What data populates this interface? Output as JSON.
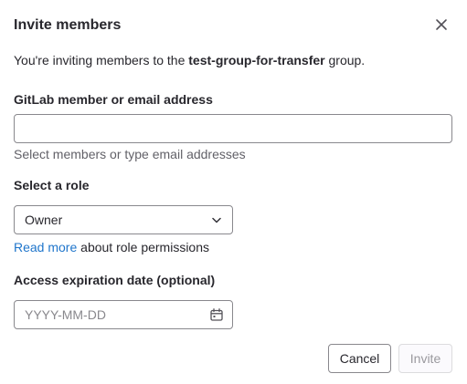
{
  "modal": {
    "title": "Invite members",
    "close_icon": "close-icon"
  },
  "intro": {
    "prefix": "You're inviting members to the ",
    "group_name": "test-group-for-transfer",
    "suffix": " group."
  },
  "member_field": {
    "label": "GitLab member or email address",
    "value": "",
    "help": "Select members or type email addresses"
  },
  "role_field": {
    "label": "Select a role",
    "selected": "Owner",
    "icon": "chevron-down-icon",
    "link_text": "Read more",
    "link_suffix": " about role permissions"
  },
  "expiration_field": {
    "label": "Access expiration date (optional)",
    "placeholder": "YYYY-MM-DD",
    "icon": "calendar-icon"
  },
  "footer": {
    "cancel_label": "Cancel",
    "invite_label": "Invite",
    "invite_disabled": true
  },
  "colors": {
    "link": "#1f75cb",
    "text": "#28272d",
    "muted": "#626168",
    "border": "#89888d"
  }
}
